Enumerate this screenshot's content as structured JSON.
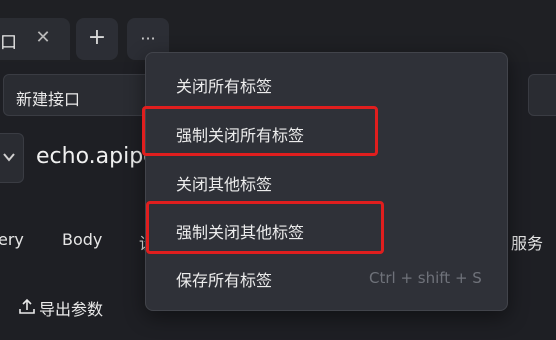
{
  "tabbar": {
    "active_tab_title": "口",
    "close_glyph": "✕",
    "add_glyph": "+",
    "more_glyph": "···"
  },
  "name_bar": {
    "value": "新建接口"
  },
  "url_row": {
    "url": "echo.apipo",
    "method_glyph": "⌄"
  },
  "sub_tabs": [
    "ery",
    "Body",
    "设",
    "服务"
  ],
  "export_button": "导出参数",
  "context_menu": {
    "items": [
      {
        "label": "关闭所有标签",
        "shortcut": ""
      },
      {
        "label": "强制关闭所有标签",
        "shortcut": ""
      },
      {
        "label": "关闭其他标签",
        "shortcut": ""
      },
      {
        "label": "强制关闭其他标签",
        "shortcut": ""
      },
      {
        "label": "保存所有标签",
        "shortcut": "Ctrl + shift + S"
      }
    ]
  },
  "highlight_color": "#e01e1e"
}
